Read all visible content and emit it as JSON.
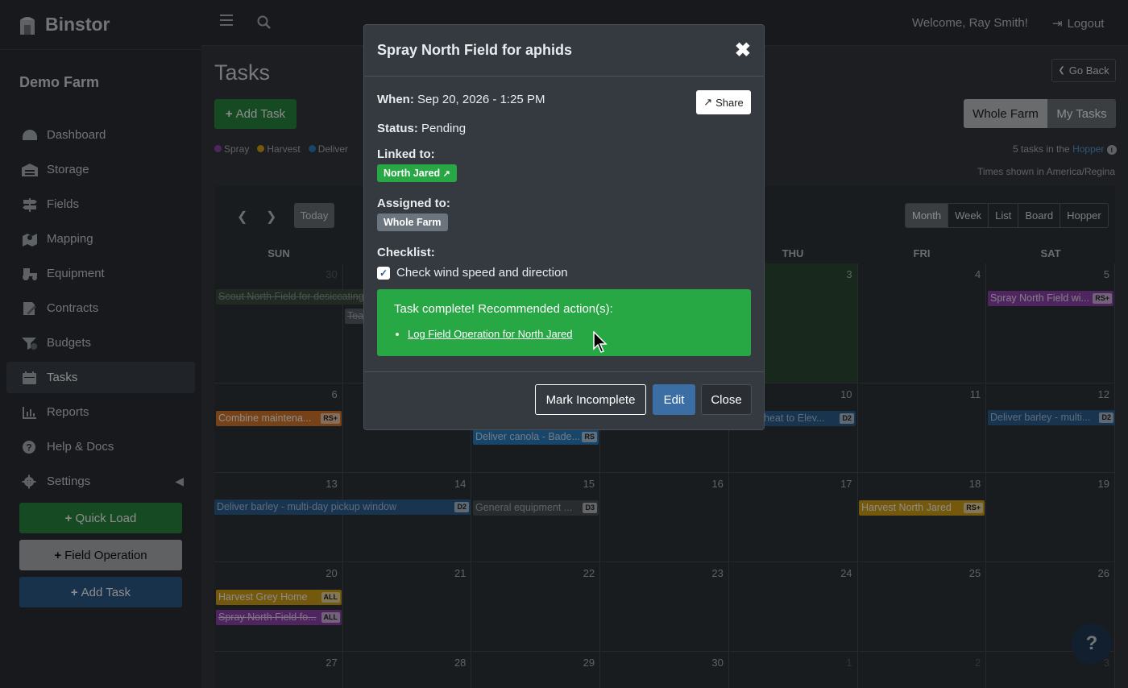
{
  "app": {
    "name": "Binstor",
    "farm": "Demo Farm"
  },
  "sidebar": {
    "items": [
      {
        "label": "Dashboard",
        "icon": "dashboard-icon"
      },
      {
        "label": "Storage",
        "icon": "warehouse-icon"
      },
      {
        "label": "Fields",
        "icon": "signpost-icon"
      },
      {
        "label": "Mapping",
        "icon": "map-marker-icon"
      },
      {
        "label": "Equipment",
        "icon": "tractor-icon"
      },
      {
        "label": "Contracts",
        "icon": "contract-icon"
      },
      {
        "label": "Budgets",
        "icon": "budget-icon"
      },
      {
        "label": "Tasks",
        "icon": "calendar-icon"
      },
      {
        "label": "Reports",
        "icon": "chart-icon"
      },
      {
        "label": "Help & Docs",
        "icon": "question-icon"
      },
      {
        "label": "Settings",
        "icon": "gear-icon"
      }
    ],
    "quick_load": "Quick Load",
    "field_operation": "Field Operation",
    "add_task": "Add Task"
  },
  "topbar": {
    "welcome": "Welcome, Ray Smith!",
    "logout": "Logout"
  },
  "page": {
    "title": "Tasks",
    "add_task": "Add Task",
    "go_back": "Go Back",
    "whole_farm": "Whole Farm",
    "my_tasks": "My Tasks",
    "legend": [
      {
        "label": "Spray",
        "color": "#8e44ad"
      },
      {
        "label": "Harvest",
        "color": "#d4a017"
      },
      {
        "label": "Deliver",
        "color": "#2d7fc1"
      }
    ],
    "tasks_count": "5 tasks in the",
    "hopper": "Hopper",
    "timezone": "Times shown in America/Regina",
    "today": "Today",
    "views": [
      "Month",
      "Week",
      "List",
      "Board",
      "Hopper"
    ]
  },
  "calendar": {
    "days": [
      "SUN",
      "",
      "",
      "",
      "THU",
      "FRI",
      "SAT"
    ],
    "weeks": [
      [
        "30",
        "",
        "",
        "",
        "3",
        "4",
        "5"
      ],
      [
        "6",
        "",
        "",
        "",
        "10",
        "11",
        "12"
      ],
      [
        "13",
        "14",
        "15",
        "16",
        "17",
        "18",
        "19"
      ],
      [
        "20",
        "21",
        "22",
        "23",
        "24",
        "25",
        "26"
      ],
      [
        "27",
        "28",
        "29",
        "30",
        "1",
        "2",
        "3"
      ]
    ],
    "events": {
      "scout": "Scout North Field for desiccating",
      "team": "Team",
      "spray_wi": "Spray North Field wi...",
      "spray_wi_tag": "RS+",
      "combine": "Combine maintena...",
      "combine_tag": "RS+",
      "deliver_canola": "Deliver canola - Bade...",
      "deliver_canola_tag": "RS",
      "wheat": "wheat to Elev...",
      "wheat_tag": "D2",
      "barley_multi": "Deliver barley - multi...",
      "barley_multi_tag": "D2",
      "barley_long": "Deliver barley - multi-day pickup window",
      "barley_long_tag": "D2",
      "general": "General equipment ...",
      "general_tag": "D3",
      "harvest_jared": "Harvest North Jared",
      "harvest_jared_tag": "RS+",
      "harvest_grey": "Harvest Grey Home",
      "harvest_grey_tag": "ALL",
      "spray_fo": "Spray North Field fo...",
      "spray_fo_tag": "ALL"
    }
  },
  "modal": {
    "title": "Spray North Field for aphids",
    "when_label": "When:",
    "when": "Sep 20, 2026 - 1:25 PM",
    "share": "Share",
    "status_label": "Status:",
    "status": "Pending",
    "linked_label": "Linked to:",
    "linked": "North Jared",
    "assigned_label": "Assigned to:",
    "assigned": "Whole Farm",
    "checklist_label": "Checklist:",
    "checklist_item": "Check wind speed and direction",
    "complete_msg": "Task complete! Recommended action(s):",
    "action_link": "Log Field Operation for North Jared",
    "mark_incomplete": "Mark Incomplete",
    "edit": "Edit",
    "close": "Close"
  },
  "help_button": "?"
}
